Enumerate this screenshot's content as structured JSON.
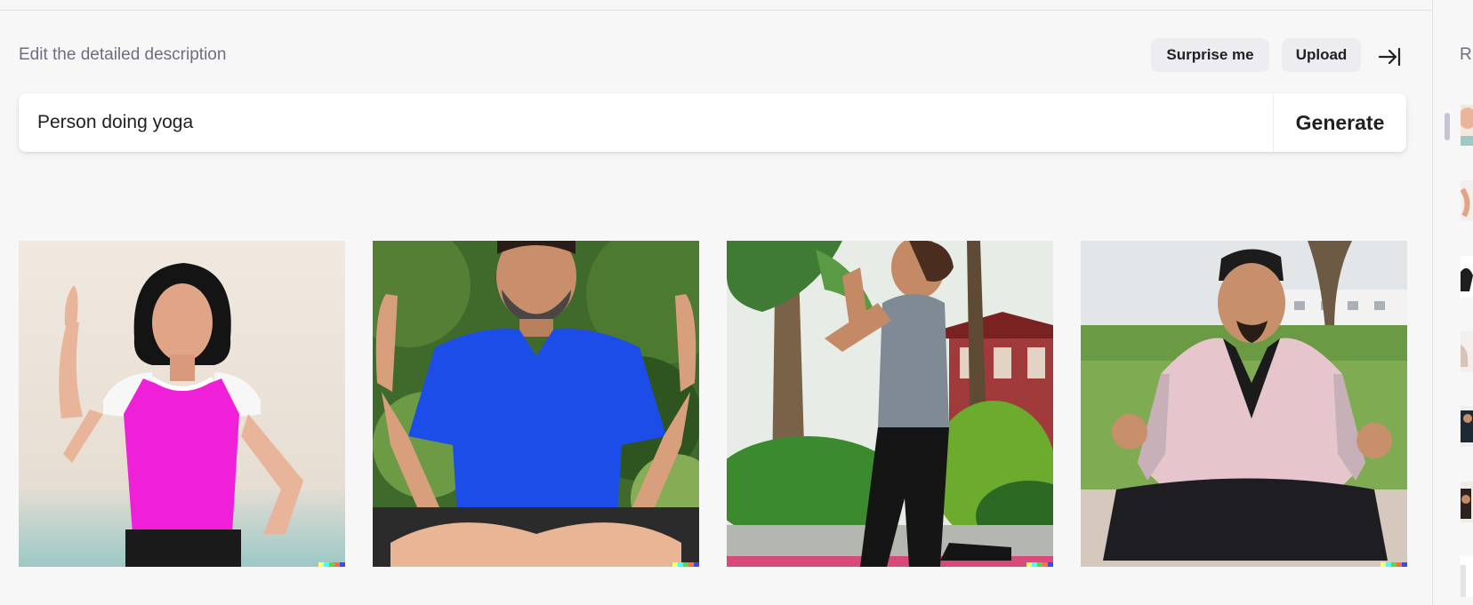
{
  "header": {
    "description_label": "Edit the detailed description",
    "surprise_label": "Surprise me",
    "upload_label": "Upload",
    "collapse_icon": "arrow-right-to-bar-icon"
  },
  "prompt": {
    "value": "Person doing yoga",
    "placeholder": "",
    "generate_label": "Generate"
  },
  "results": [
    {
      "name": "yoga-woman-pink-top"
    },
    {
      "name": "yoga-man-blue-shirt"
    },
    {
      "name": "yoga-woman-palm-trees"
    },
    {
      "name": "yoga-man-pink-jacket"
    }
  ],
  "right_panel": {
    "heading": "R",
    "thumbnail_count": 7
  },
  "colors": {
    "background": "#f7f7f8",
    "text": "#202123",
    "muted": "#6e6e80",
    "pill": "#ececf1"
  }
}
